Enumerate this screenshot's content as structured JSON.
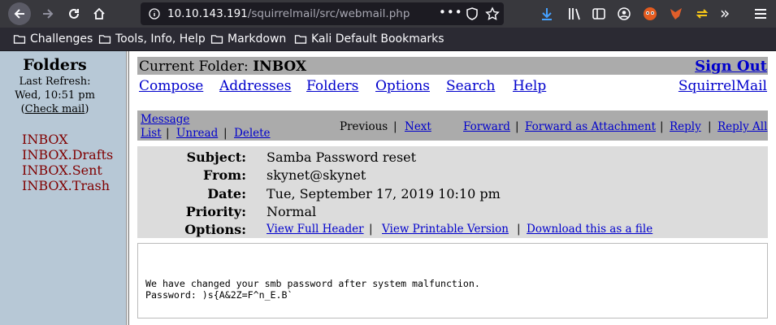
{
  "browser": {
    "url_host": "10.10.143.191",
    "url_path": "/squirrelmail/src/webmail.php",
    "bookmarks": [
      "Challenges",
      "Tools, Info, Help",
      "Markdown",
      "Kali Default Bookmarks"
    ]
  },
  "sidebar": {
    "title": "Folders",
    "last_refresh_label": "Last  Refresh:",
    "last_refresh_time": "Wed,  10:51  pm",
    "check_mail_open": "(",
    "check_mail": "Check mail",
    "check_mail_close": ")",
    "folders": [
      "INBOX",
      "INBOX.Drafts",
      "INBOX.Sent",
      "INBOX.Trash"
    ]
  },
  "top": {
    "current_folder_label": "Current Folder: ",
    "current_folder": "INBOX",
    "sign_out": "Sign Out",
    "nav": [
      "Compose",
      "Addresses",
      "Folders",
      "Options",
      "Search",
      "Help"
    ],
    "brand": "SquirrelMail"
  },
  "message_bar": {
    "message_list_1": "Message",
    "message_list_2": "List",
    "unread": "Unread",
    "delete": "Delete",
    "previous": "Previous",
    "next": "Next",
    "forward": "Forward",
    "forward_attachment": "Forward as Attachment",
    "reply": "Reply",
    "reply_all": "Reply All",
    "separator": "|"
  },
  "headers": {
    "subject_label": "Subject:",
    "subject": "Samba Password reset",
    "from_label": "From:",
    "from": "skynet@skynet",
    "date_label": "Date:",
    "date": "Tue, September 17, 2019 10:10 pm",
    "priority_label": "Priority:",
    "priority": "Normal",
    "options_label": "Options:",
    "view_full_header": "View Full Header",
    "view_printable": "View Printable Version",
    "download": "Download this as a file"
  },
  "body": {
    "line1": "We have changed your smb password after system malfunction.",
    "line2": "Password: )s{A&2Z=F^n_E.B`"
  },
  "colors": {
    "left_pane": "#b7c8d6",
    "folder_link": "#800000",
    "link": "#0000cc",
    "header_bar": "#ababab",
    "header_box": "#dcdcdc"
  }
}
